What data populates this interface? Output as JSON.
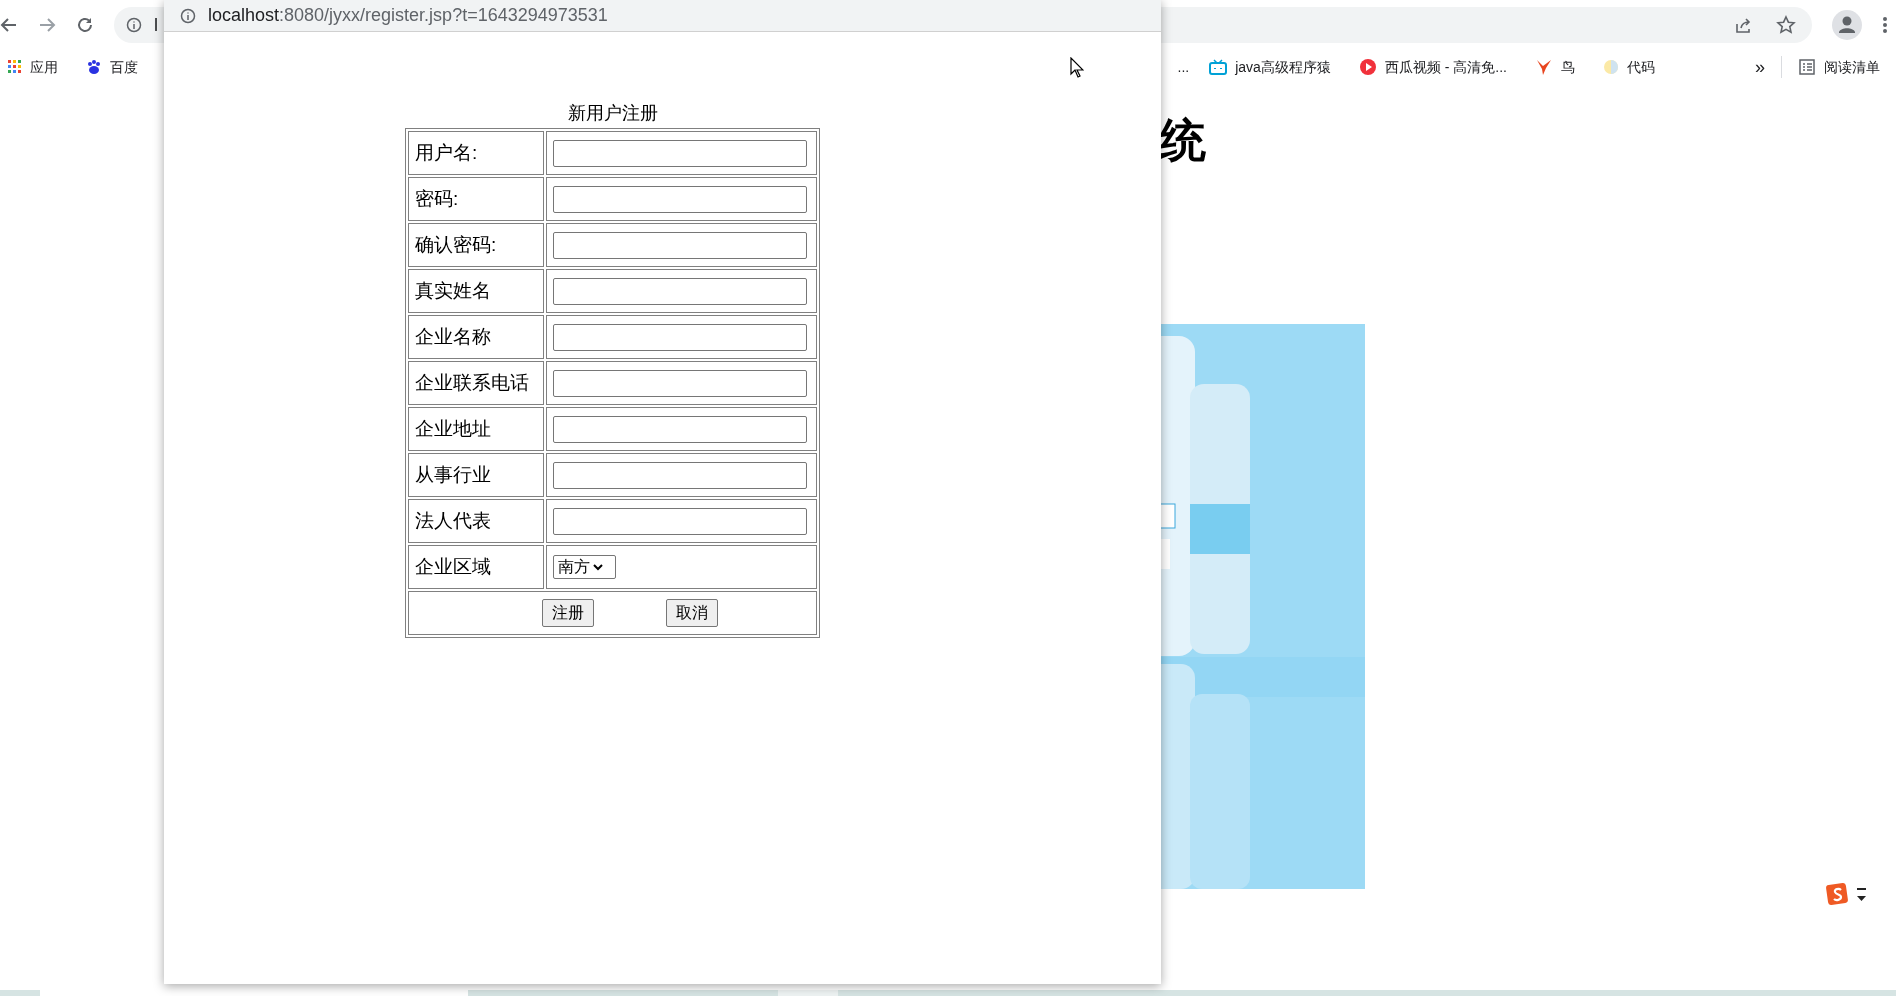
{
  "browser": {
    "address_partial": "l",
    "bookmarks_left": [
      {
        "label": "应用",
        "kind": "apps"
      },
      {
        "label": "百度",
        "kind": "paw"
      }
    ],
    "bookmarks_right": [
      {
        "label": "java高级程序猿",
        "kind": "tv"
      },
      {
        "label": "西瓜视频 - 高清免...",
        "kind": "play"
      },
      {
        "label": "鸟",
        "kind": "bird"
      },
      {
        "label": "代码",
        "kind": "moon"
      }
    ],
    "bookmarks_more": "»",
    "reading_list": "阅读清单",
    "overflow_ellipsis": "..."
  },
  "page": {
    "heading_partial": "统"
  },
  "popup": {
    "url_host": "localhost",
    "url_rest": ":8080/jyxx/register.jsp?t=1643294973531",
    "form": {
      "title": "新用户注册",
      "fields": [
        {
          "label": "用户名:",
          "kind": "input"
        },
        {
          "label": "密码:",
          "kind": "input"
        },
        {
          "label": "确认密码:",
          "kind": "input"
        },
        {
          "label": "真实姓名",
          "kind": "input"
        },
        {
          "label": "企业名称",
          "kind": "input"
        },
        {
          "label": "企业联系电话",
          "kind": "input"
        },
        {
          "label": "企业地址",
          "kind": "input"
        },
        {
          "label": "从事行业",
          "kind": "input"
        },
        {
          "label": "法人代表",
          "kind": "input"
        },
        {
          "label": "企业区域",
          "kind": "select",
          "value": "南方"
        }
      ],
      "buttons": [
        "注册",
        "取消"
      ]
    }
  }
}
